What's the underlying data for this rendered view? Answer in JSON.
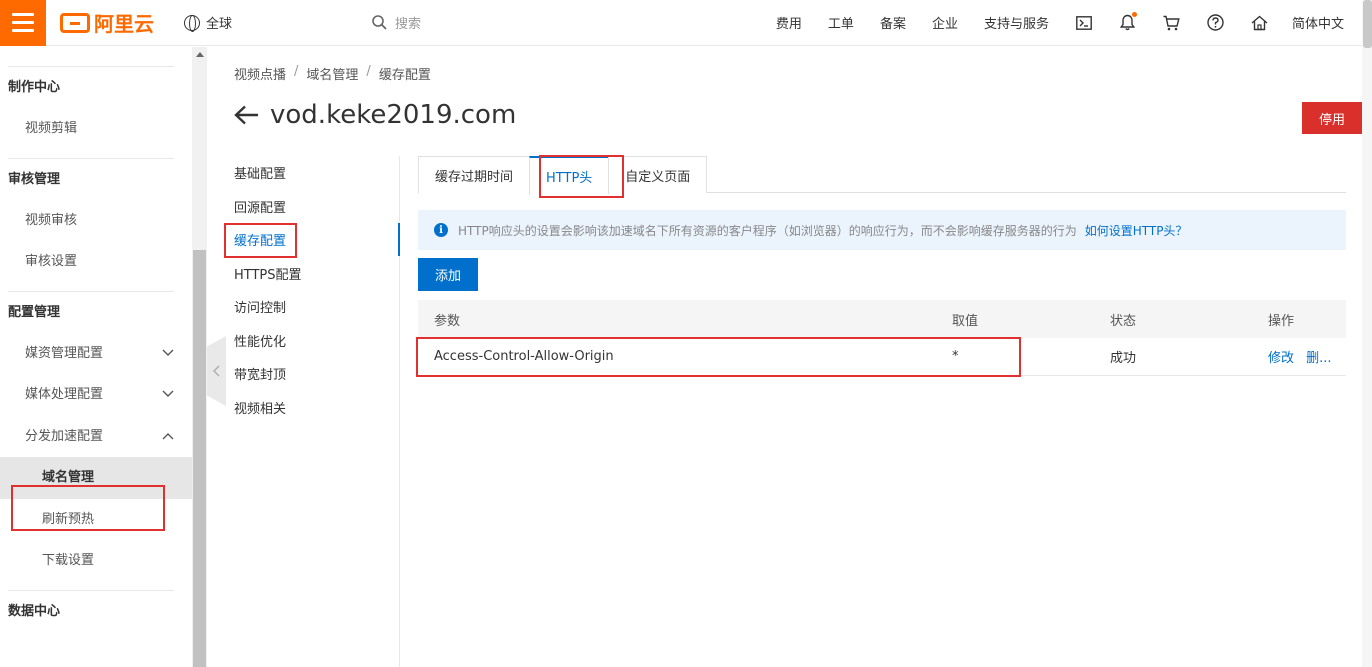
{
  "topbar": {
    "logo_text": "阿里云",
    "region": "全球",
    "search_placeholder": "搜索",
    "nav": [
      "费用",
      "工单",
      "备案",
      "企业",
      "支持与服务"
    ],
    "language": "简体中文",
    "accent_color": "#ff6a00"
  },
  "sidebar": {
    "groups": [
      {
        "title": "制作中心",
        "items": [
          {
            "label": "视频剪辑"
          }
        ]
      },
      {
        "title": "审核管理",
        "items": [
          {
            "label": "视频审核"
          },
          {
            "label": "审核设置"
          }
        ]
      },
      {
        "title": "配置管理",
        "items": [
          {
            "label": "媒资管理配置",
            "chevron": "down"
          },
          {
            "label": "媒体处理配置",
            "chevron": "down"
          },
          {
            "label": "分发加速配置",
            "chevron": "up"
          },
          {
            "label": "域名管理",
            "active": true
          },
          {
            "label": "刷新预热"
          },
          {
            "label": "下载设置"
          }
        ]
      },
      {
        "title": "数据中心",
        "items": []
      }
    ]
  },
  "breadcrumb": [
    "视频点播",
    "域名管理",
    "缓存配置"
  ],
  "page": {
    "title": "vod.keke2019.com",
    "stop_button": "停用"
  },
  "subnav": [
    "基础配置",
    "回源配置",
    "缓存配置",
    "HTTPS配置",
    "访问控制",
    "性能优化",
    "带宽封顶",
    "视频相关"
  ],
  "subnav_active_index": 2,
  "tabs": [
    "缓存过期时间",
    "HTTP头",
    "自定义页面"
  ],
  "tabs_active_index": 1,
  "notice": {
    "text": "HTTP响应头的设置会影响该加速域名下所有资源的客户程序（如浏览器）的响应行为，而不会影响缓存服务器的行为",
    "link": "如何设置HTTP头？"
  },
  "add_button": "添加",
  "table": {
    "headers": [
      "参数",
      "取值",
      "状态",
      "操作"
    ],
    "rows": [
      {
        "param": "Access-Control-Allow-Origin",
        "value": "*",
        "status": "成功",
        "edit": "修改",
        "delete": "删..."
      }
    ]
  },
  "colors": {
    "primary": "#0070cc",
    "danger": "#d9302c",
    "highlight": "#e03030"
  }
}
